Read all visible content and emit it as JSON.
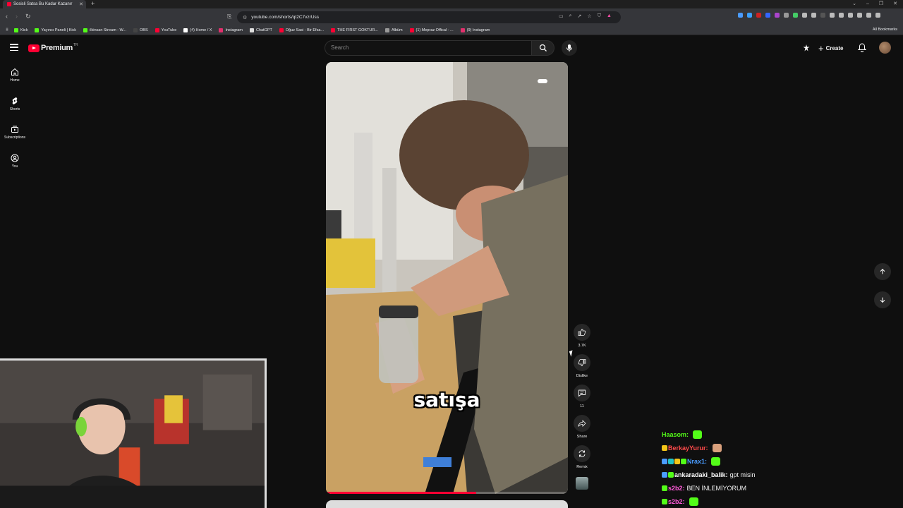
{
  "browser": {
    "tab_title": "Sosisli Satsa Bu Kadar Kazanır",
    "url": "youtube.com/shorts/qt2C7vzrUss",
    "bookmarks": [
      {
        "label": "Kick",
        "color": "#53fc18"
      },
      {
        "label": "Yayıncı Paneli | Kick",
        "color": "#53fc18"
      },
      {
        "label": "ilkinsan Stream - W...",
        "color": "#53fc18"
      },
      {
        "label": "OBS",
        "color": "#444444"
      },
      {
        "label": "YouTube",
        "color": "#ff0033"
      },
      {
        "label": "(4) Home / X",
        "color": "#ffffff"
      },
      {
        "label": "Instagram",
        "color": "#e1306c"
      },
      {
        "label": "ChatGPT",
        "color": "#dddddd"
      },
      {
        "label": "Oğuz Sasi - Bir Efsa...",
        "color": "#ff0033"
      },
      {
        "label": "THE FIRST GOKTUR...",
        "color": "#ff0033"
      },
      {
        "label": "Albüm",
        "color": "#999999"
      },
      {
        "label": "(1) Mepraz Offical - ...",
        "color": "#ff0033"
      },
      {
        "label": "(9) Instagram",
        "color": "#e1306c"
      }
    ],
    "all_bookmarks": "All Bookmarks"
  },
  "youtube": {
    "logo_text": "Premium",
    "logo_region": "TR",
    "search_placeholder": "Search",
    "create_label": "Create",
    "sidebar": [
      {
        "label": "Home",
        "icon": "home-icon"
      },
      {
        "label": "Shorts",
        "icon": "shorts-icon"
      },
      {
        "label": "Subscriptions",
        "icon": "subscriptions-icon"
      },
      {
        "label": "You",
        "icon": "you-icon"
      }
    ],
    "short": {
      "caption": "satışa",
      "progress": 0.62,
      "actions": [
        {
          "label": "3.7K",
          "icon": "like-icon"
        },
        {
          "label": "Dislike",
          "icon": "dislike-icon"
        },
        {
          "label": "11",
          "icon": "comment-icon"
        },
        {
          "label": "Share",
          "icon": "share-icon"
        },
        {
          "label": "Remix",
          "icon": "remix-icon"
        }
      ]
    }
  },
  "chat": [
    {
      "user": "Haasom:",
      "color": "#53fc18",
      "message": "",
      "badges": [],
      "emote": "#53fc18"
    },
    {
      "user": "BerkayYurur:",
      "color": "#ff4a4a",
      "message": "",
      "badges": [
        "#f5c518"
      ],
      "emote": "#d9a07c"
    },
    {
      "user": "Nrax1:",
      "color": "#4a9cff",
      "message": "",
      "badges": [
        "#4a9cff",
        "#22c3c3",
        "#f5c518",
        "#53fc18"
      ],
      "emote": "#53fc18"
    },
    {
      "user": "ankaradaki_balik:",
      "color": "#ffffff",
      "message": "gpt misin",
      "badges": [
        "#4a9cff",
        "#53fc18"
      ],
      "emote": ""
    },
    {
      "user": "s2b2:",
      "color": "#ff5ad9",
      "message": "BEN İNLEMİYORUM",
      "badges": [
        "#53fc18"
      ],
      "emote": ""
    },
    {
      "user": "s2b2:",
      "color": "#ff5ad9",
      "message": "",
      "badges": [
        "#53fc18"
      ],
      "emote": "#53fc18"
    }
  ]
}
